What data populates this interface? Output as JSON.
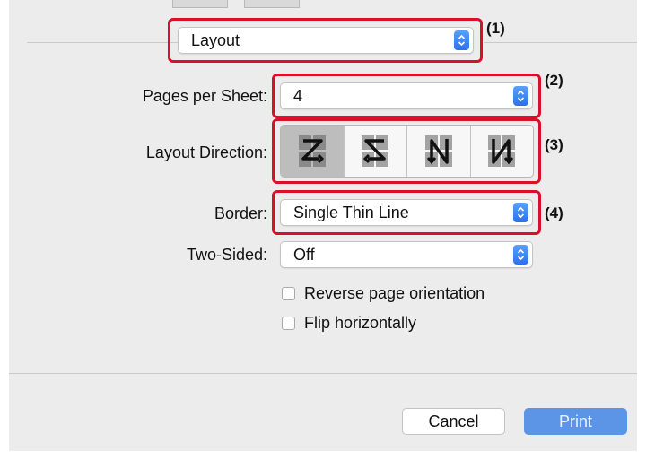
{
  "section_popup": {
    "value": "Layout",
    "callout": "(1)"
  },
  "pages_per_sheet": {
    "label": "Pages per Sheet:",
    "value": "4",
    "callout": "(2)"
  },
  "layout_direction": {
    "label": "Layout Direction:",
    "callout": "(3)",
    "options": [
      {
        "icon": "z-order-icon",
        "selected": true
      },
      {
        "icon": "reverse-z-order-icon",
        "selected": false
      },
      {
        "icon": "n-order-reverse-icon",
        "selected": false
      },
      {
        "icon": "n-order-icon",
        "selected": false
      }
    ]
  },
  "border": {
    "label": "Border:",
    "value": "Single Thin Line",
    "callout": "(4)"
  },
  "two_sided": {
    "label": "Two-Sided:",
    "value": "Off"
  },
  "checkboxes": [
    {
      "label": "Reverse page orientation",
      "checked": false
    },
    {
      "label": "Flip horizontally",
      "checked": false
    }
  ],
  "buttons": {
    "cancel": "Cancel",
    "print": "Print"
  },
  "colors": {
    "callout": "#d8102b",
    "accent": "#2a72e8",
    "print_button": "#5d95e6"
  }
}
